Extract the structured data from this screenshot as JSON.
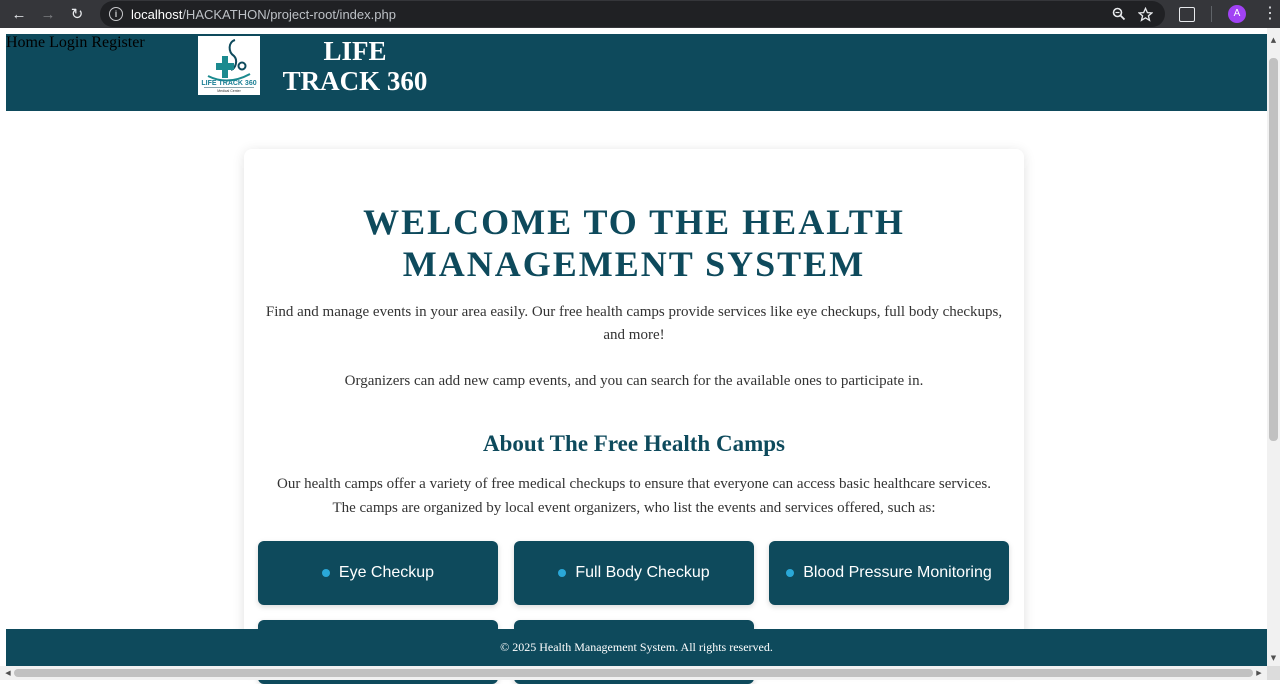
{
  "browser": {
    "url_host": "localhost",
    "url_path": "/HACKATHON/project-root/index.php",
    "profile_initial": "A"
  },
  "header": {
    "brand_line1": "LIFE",
    "brand_line2": "TRACK 360",
    "logo_text": "LIFE TRACK 360",
    "logo_subtext": "Medical Center",
    "nav": [
      "Home",
      "Login",
      "Register"
    ]
  },
  "main": {
    "title_line1": "WELCOME TO THE HEALTH",
    "title_line2": "MANAGEMENT SYSTEM",
    "intro": "Find and manage events in your area easily. Our free health camps provide services like eye checkups, full body checkups, and more!",
    "organizers": "Organizers can add new camp events, and you can search for the available ones to participate in.",
    "about_title": "About The Free Health Camps",
    "about_text": "Our health camps offer a variety of free medical checkups to ensure that everyone can access basic healthcare services. The camps are organized by local event organizers, who list the events and services offered, such as:",
    "services": [
      "Eye Checkup",
      "Full Body Checkup",
      "Blood Pressure Monitoring"
    ]
  },
  "footer": {
    "text": "© 2025 Health Management System. All rights reserved."
  },
  "colors": {
    "primary": "#0e4a5c",
    "accent_dot": "#2aa8d8",
    "chrome": "#35363a"
  }
}
